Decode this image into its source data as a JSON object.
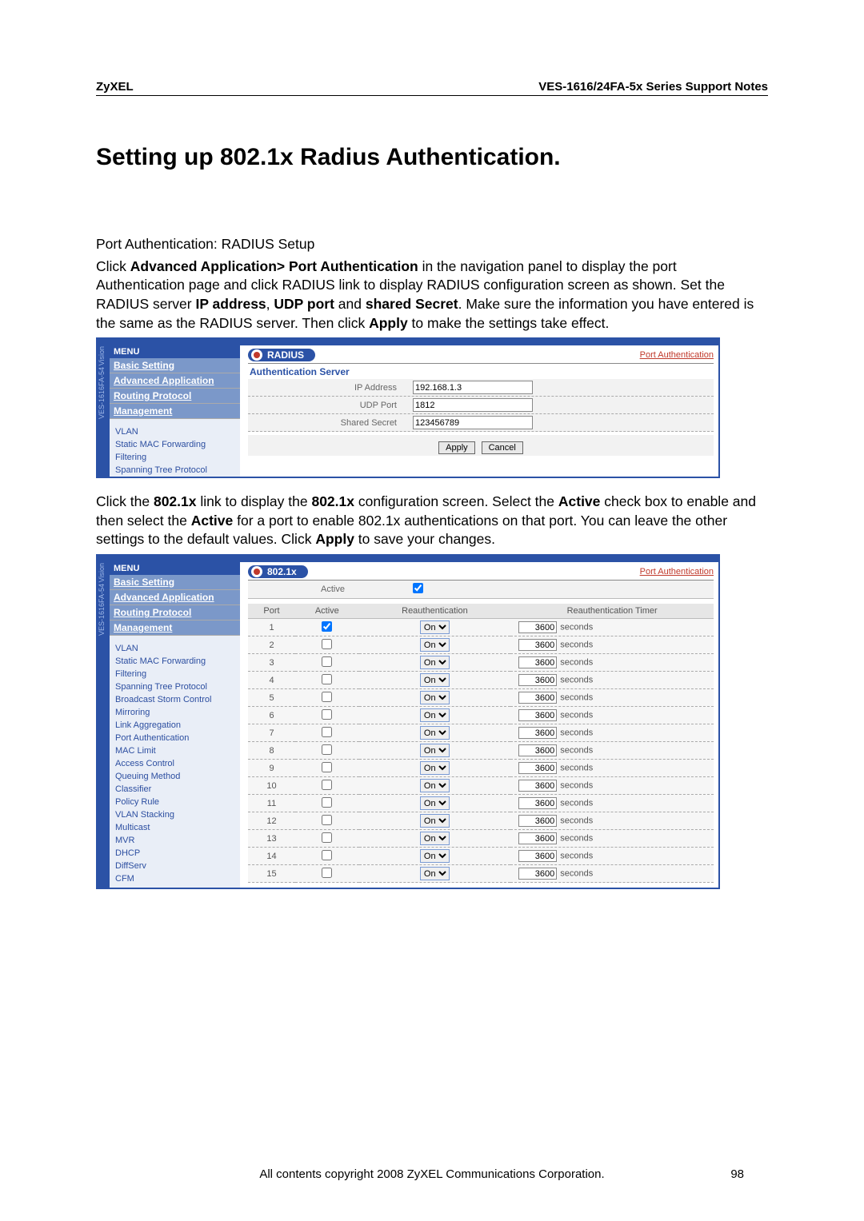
{
  "header": {
    "left": "ZyXEL",
    "right": "VES-1616/24FA-5x Series Support Notes"
  },
  "title": "Setting up 802.1x Radius Authentication.",
  "p1": "Port Authentication: RADIUS Setup",
  "p2a": "Click ",
  "p2b": "Advanced Application> Port Authentication",
  "p2c": " in the navigation panel to display the port Authentication page and click RADIUS link to display RADIUS configuration screen as shown. Set the RADIUS server ",
  "p2d": "IP address",
  "p2e": ", ",
  "p2f": "UDP port",
  "p2g": " and ",
  "p2h": "shared Secret",
  "p2i": ". Make sure the information you have entered is the same as the RADIUS server. Then click ",
  "p2j": "Apply",
  "p2k": " to make the settings take effect.",
  "p3a": "Click the ",
  "p3b": "802.1x",
  "p3c": " link to display the ",
  "p3d": "802.1x",
  "p3e": " configuration screen. Select the ",
  "p3f": "Active",
  "p3g": " check box to enable and then select the ",
  "p3h": "Active",
  "p3i": " for a port to enable 802.1x authentications on that port. You can leave the other settings to the default values. Click ",
  "p3j": "Apply",
  "p3k": " to save your changes.",
  "sidebar": {
    "tab1": "Vision",
    "tab2": "VES-1616FA-54",
    "menu_hdr": "MENU",
    "top": [
      "Basic Setting",
      "Advanced Application",
      "Routing Protocol",
      "Management"
    ],
    "sub1": [
      "VLAN",
      "Static MAC Forwarding",
      "Filtering",
      "Spanning Tree Protocol"
    ],
    "sub2": [
      "VLAN",
      "Static MAC Forwarding",
      "Filtering",
      "Spanning Tree Protocol",
      "Broadcast Storm Control",
      "Mirroring",
      "Link Aggregation",
      "Port Authentication",
      "MAC Limit",
      "Access Control",
      "Queuing Method",
      "Classifier",
      "Policy Rule",
      "VLAN Stacking",
      "Multicast",
      "MVR",
      "DHCP",
      "DiffServ",
      "CFM"
    ]
  },
  "radius": {
    "pill": "RADIUS",
    "pa_link": "Port Authentication",
    "section": "Authentication Server",
    "rows": {
      "ip_label": "IP Address",
      "ip_value": "192.168.1.3",
      "udp_label": "UDP Port",
      "udp_value": "1812",
      "secret_label": "Shared Secret",
      "secret_value": "123456789"
    },
    "apply": "Apply",
    "cancel": "Cancel"
  },
  "dot1x": {
    "pill": "802.1x",
    "pa_link": "Port Authentication",
    "active_label": "Active",
    "cols": {
      "port": "Port",
      "active": "Active",
      "reauth": "Reauthentication",
      "timer": "Reauthentication Timer"
    },
    "reauth_option": "On",
    "seconds": "seconds",
    "rows": [
      {
        "port": "1",
        "active": true,
        "timer": "3600"
      },
      {
        "port": "2",
        "active": false,
        "timer": "3600"
      },
      {
        "port": "3",
        "active": false,
        "timer": "3600"
      },
      {
        "port": "4",
        "active": false,
        "timer": "3600"
      },
      {
        "port": "5",
        "active": false,
        "timer": "3600"
      },
      {
        "port": "6",
        "active": false,
        "timer": "3600"
      },
      {
        "port": "7",
        "active": false,
        "timer": "3600"
      },
      {
        "port": "8",
        "active": false,
        "timer": "3600"
      },
      {
        "port": "9",
        "active": false,
        "timer": "3600"
      },
      {
        "port": "10",
        "active": false,
        "timer": "3600"
      },
      {
        "port": "11",
        "active": false,
        "timer": "3600"
      },
      {
        "port": "12",
        "active": false,
        "timer": "3600"
      },
      {
        "port": "13",
        "active": false,
        "timer": "3600"
      },
      {
        "port": "14",
        "active": false,
        "timer": "3600"
      },
      {
        "port": "15",
        "active": false,
        "timer": "3600"
      }
    ]
  },
  "footer": "All contents copyright 2008 ZyXEL Communications Corporation.",
  "pageno": "98"
}
